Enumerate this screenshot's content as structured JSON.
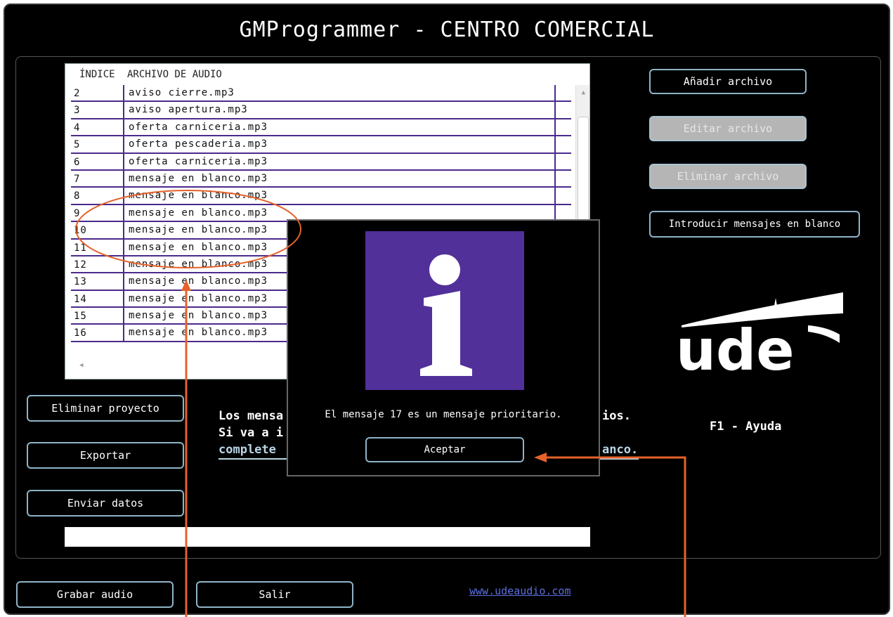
{
  "window": {
    "title": "GMProgrammer - CENTRO COMERCIAL"
  },
  "table": {
    "headers": [
      "ÍNDICE",
      "ARCHIVO DE AUDIO"
    ],
    "rows": [
      {
        "index": "2",
        "file": "aviso cierre.mp3"
      },
      {
        "index": "3",
        "file": "aviso apertura.mp3"
      },
      {
        "index": "4",
        "file": "oferta carniceria.mp3"
      },
      {
        "index": "5",
        "file": "oferta pescaderia.mp3"
      },
      {
        "index": "6",
        "file": "oferta carniceria.mp3"
      },
      {
        "index": "7",
        "file": "mensaje en blanco.mp3"
      },
      {
        "index": "8",
        "file": "mensaje en blanco.mp3"
      },
      {
        "index": "9",
        "file": "mensaje en blanco.mp3"
      },
      {
        "index": "10",
        "file": "mensaje en blanco.mp3"
      },
      {
        "index": "11",
        "file": "mensaje en blanco.mp3"
      },
      {
        "index": "12",
        "file": "mensaje en blanco.mp3"
      },
      {
        "index": "13",
        "file": "mensaje en blanco.mp3"
      },
      {
        "index": "14",
        "file": "mensaje en blanco.mp3"
      },
      {
        "index": "15",
        "file": "mensaje en blanco.mp3"
      },
      {
        "index": "16",
        "file": "mensaje en blanco.mp3"
      }
    ]
  },
  "right_buttons": {
    "add": "Añadir archivo",
    "edit": "Editar archivo",
    "delete": "Eliminar archivo",
    "blank": "Introducir mensajes en blanco"
  },
  "left_buttons": {
    "delete_project": "Eliminar proyecto",
    "export": "Exportar",
    "send": "Enviar datos"
  },
  "bottom_buttons": {
    "record": "Grabar audio",
    "exit": "Salir"
  },
  "message": {
    "line1_start": "Los mensa",
    "line1_end": "ios.",
    "line2_start": "Si va a i",
    "line3_start": "complete",
    "line3_end": "anco."
  },
  "help": "F1 - Ayuda",
  "link": "www.udeaudio.com",
  "logo_text": "ude",
  "dialog": {
    "text": "El mensaje 17 es un mensaje prioritario.",
    "ok": "Aceptar",
    "icon": "info-icon"
  },
  "colors": {
    "accent_purple": "#52309a",
    "annotation_orange": "#e5622a",
    "button_border": "#8fb3c7"
  }
}
